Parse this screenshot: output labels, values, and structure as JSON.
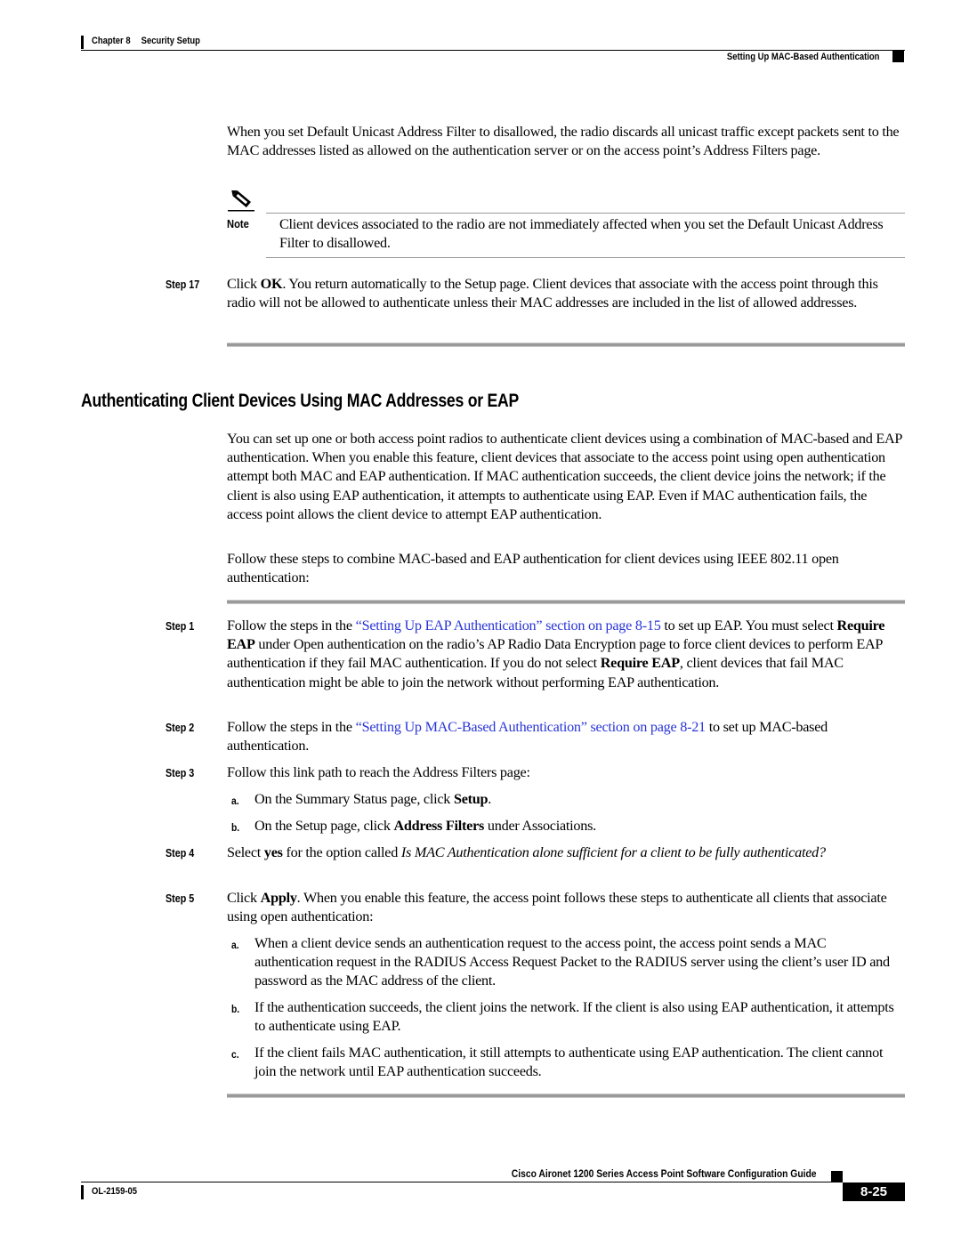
{
  "header": {
    "chapter": "Chapter 8",
    "section": "Security Setup",
    "running_title": "Setting Up MAC-Based Authentication"
  },
  "intro_paragraph": "When you set Default Unicast Address Filter to disallowed, the radio discards all unicast traffic except packets sent to the MAC addresses listed as allowed on the authentication server or on the access point’s Address Filters page.",
  "note": {
    "icon": "pencil-note-icon",
    "label": "Note",
    "text": "Client devices associated to the radio are not immediately affected when you set the Default Unicast Address Filter to disallowed."
  },
  "step17": {
    "label": "Step 17",
    "pre": "Click ",
    "bold": "OK",
    "post": ". You return automatically to the Setup page. Client devices that associate with the access point through this radio will not be allowed to authenticate unless their MAC addresses are included in the list of allowed addresses."
  },
  "section": {
    "title": "Authenticating Client Devices Using MAC Addresses or EAP",
    "paragraph1": "You can set up one or both access point radios to authenticate client devices using a combination of MAC-based and EAP authentication. When you enable this feature, client devices that associate to the access point using open authentication attempt both MAC and EAP authentication. If MAC authentication succeeds, the client device joins the network; if the client is also using EAP authentication, it attempts to authenticate using EAP. Even if MAC authentication fails, the access point allows the client device to attempt EAP authentication.",
    "paragraph2": "Follow these steps to combine MAC-based and EAP authentication for client devices using IEEE 802.11 open authentication:"
  },
  "steps": {
    "s1": {
      "label": "Step 1",
      "pre": "Follow the steps in the ",
      "link": "“Setting Up EAP Authentication” section on page 8-15",
      "mid1": " to set up EAP. You must select ",
      "bold1": "Require EAP",
      "mid2": " under Open authentication on the radio’s AP Radio Data Encryption page to force client devices to perform EAP authentication if they fail MAC authentication. If you do not select ",
      "bold2": "Require EAP",
      "post": ", client devices that fail MAC authentication might be able to join the network without performing EAP authentication."
    },
    "s2": {
      "label": "Step 2",
      "pre": "Follow the steps in the ",
      "link": "“Setting Up MAC-Based Authentication” section on page 8-21",
      "post": " to set up MAC-based authentication."
    },
    "s3": {
      "label": "Step 3",
      "text": "Follow this link path to reach the Address Filters page:",
      "a": {
        "label": "a.",
        "pre": "On the Summary Status page, click ",
        "bold": "Setup",
        "post": "."
      },
      "b": {
        "label": "b.",
        "pre": "On the Setup page, click ",
        "bold": "Address Filters",
        "post": " under Associations."
      }
    },
    "s4": {
      "label": "Step 4",
      "pre": "Select ",
      "bold": "yes",
      "mid": " for the option called ",
      "italic": "Is MAC Authentication alone sufficient for a client to be fully authenticated?"
    },
    "s5": {
      "label": "Step 5",
      "pre": "Click ",
      "bold": "Apply",
      "post": ". When you enable this feature, the access point follows these steps to authenticate all clients that associate using open authentication:",
      "a": {
        "label": "a.",
        "text": "When a client device sends an authentication request to the access point, the access point sends a MAC authentication request in the RADIUS Access Request Packet to the RADIUS server using the client’s user ID and password as the MAC address of the client."
      },
      "b": {
        "label": "b.",
        "text": "If the authentication succeeds, the client joins the network. If the client is also using EAP authentication, it attempts to authenticate using EAP."
      },
      "c": {
        "label": "c.",
        "text": "If the client fails MAC authentication, it still attempts to authenticate using EAP authentication. The client cannot join the network until EAP authentication succeeds."
      }
    }
  },
  "footer": {
    "guide_title": "Cisco Aironet 1200 Series Access Point Software Configuration Guide",
    "doc_number": "OL-2159-05",
    "page_number": "8-25"
  }
}
